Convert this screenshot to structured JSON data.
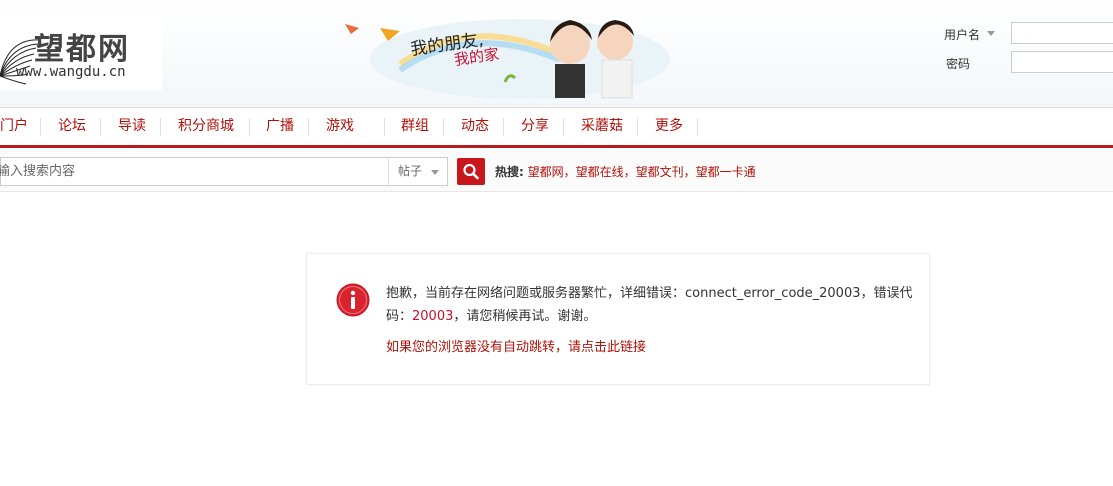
{
  "header": {
    "logo_title": "望都网",
    "logo_url": "www.wangdu.cn",
    "slogan_line1": "我的朋友,",
    "slogan_line2": "我的家"
  },
  "login": {
    "username_label": "用户名",
    "password_label": "密码"
  },
  "nav": {
    "items": [
      "门户",
      "论坛",
      "导读",
      "积分商城",
      "广播",
      "游戏",
      "群组",
      "动态",
      "分享",
      "采蘑菇",
      "更多"
    ]
  },
  "search": {
    "placeholder": "输入搜索内容",
    "type_selected": "帖子",
    "hot_label": "热搜:",
    "hot_links": "望都网，望都在线，望都文刊，望都一卡通"
  },
  "error": {
    "message_pre": "抱歉，当前存在网络问题或服务器繁忙，详细错误：connect_error_code_20003，错误代码：",
    "code": "20003",
    "message_post": "，请您稍候再试。谢谢。",
    "redirect_link": "如果您的浏览器没有自动跳转，请点击此链接"
  },
  "colors": {
    "brand_red": "#c8161d",
    "link_red": "#b0120a"
  }
}
